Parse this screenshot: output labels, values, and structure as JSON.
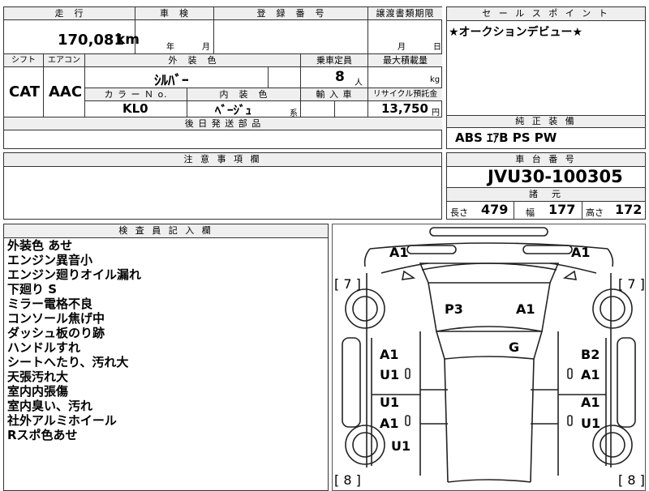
{
  "top": {
    "mileage_label": "走　行",
    "mileage_value": "170,081",
    "mileage_unit": "km",
    "inspection_label": "車　検",
    "inspection_year_unit": "年",
    "inspection_month_unit": "月",
    "registration_label": "登　録　番　号",
    "transfer_label": "譲渡書類期限",
    "transfer_month_unit": "月",
    "transfer_day_unit": "日",
    "shift_label": "シフト",
    "shift_value": "CAT",
    "ac_label": "エアコン",
    "ac_value": "AAC",
    "exterior_label": "外　装　色",
    "exterior_value": "ｼﾙﾊﾞｰ",
    "capacity_label": "乗車定員",
    "capacity_value": "8",
    "capacity_unit": "人",
    "load_label": "最大積載量",
    "load_unit": "kg",
    "colorno_label": "カ ラ ー Ｎ o.",
    "colorno_value": "KL0",
    "interior_label": "内　装　色",
    "interior_value": "ﾍﾞｰｼﾞｭ",
    "interior_suffix": "系",
    "import_label": "輸 入 車",
    "recycle_label": "リサイクル預託金",
    "recycle_value": "13,750",
    "recycle_unit": "円",
    "parts_label": "後 日 発 送 部 品"
  },
  "sales": {
    "label": "セ ー ル ス ポ イ ン ト",
    "value": "★オークションデビュー★"
  },
  "equipment": {
    "label": "純 正 装 備",
    "value": "ABS ｴｱB PS PW"
  },
  "caution": {
    "label": "注 意 事 項 欄"
  },
  "chassis": {
    "label": "車 台 番 号",
    "value": "JVU30-100305",
    "dims_label": "諸　元",
    "length_label": "長さ",
    "length_value": "479",
    "width_label": "幅",
    "width_value": "177",
    "height_label": "高さ",
    "height_value": "172"
  },
  "inspector": {
    "label": "検 査 員 記 入 欄",
    "notes": [
      "外装色 あせ",
      "エンジン異音小",
      "エンジン廻りオイル漏れ",
      "下廻り S",
      "ミラー電格不良",
      "コンソール焦げ中",
      "ダッシュ板のり跡",
      "ハンドルすれ",
      "シートへたり、汚れ大",
      "天張汚れ大",
      "室内内張傷",
      "室内臭い、汚れ",
      "社外アルミホイール",
      "Rスポ色あせ"
    ]
  },
  "diagram": {
    "marks": {
      "front_left": "A1",
      "front_right": "A1",
      "bracket_left_top": "[ 7 ]",
      "bracket_right_top": "[ 7 ]",
      "bracket_left_bottom": "[ 8 ]",
      "bracket_right_bottom": "[ 8 ]",
      "hood_left": "P3",
      "hood_right": "A1",
      "windshield": "G",
      "left_front_door_1": "A1",
      "left_front_door_2": "U1",
      "left_rear_door_1": "U1",
      "left_rear_door_2": "A1",
      "left_rear_wheel": "U1",
      "right_front_door_1": "B2",
      "right_front_door_2": "A1",
      "right_rear_door_1": "A1",
      "right_rear_door_2": "U1"
    }
  }
}
